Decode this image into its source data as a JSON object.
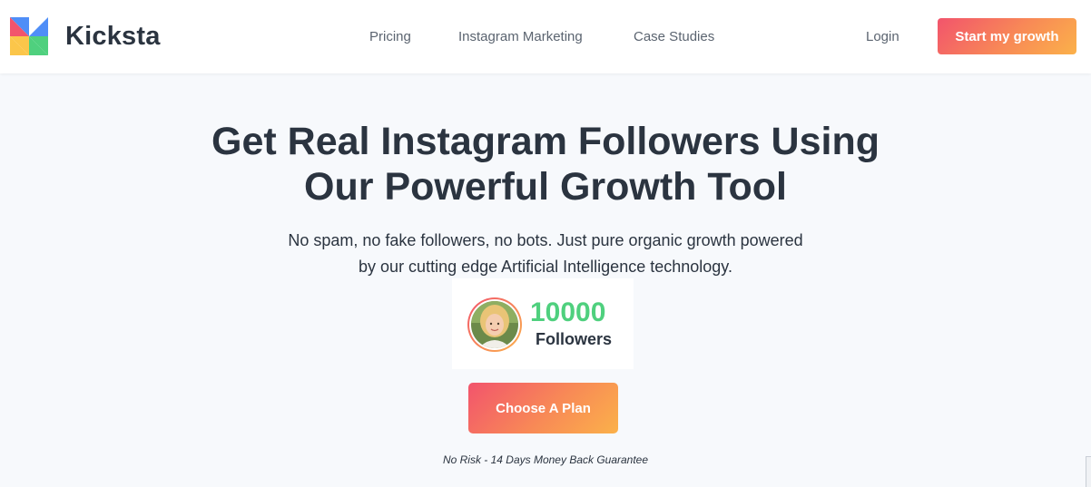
{
  "header": {
    "brand": "Kicksta",
    "nav": [
      {
        "label": "Pricing"
      },
      {
        "label": "Instagram Marketing"
      },
      {
        "label": "Case Studies"
      }
    ],
    "login_label": "Login",
    "cta_label": "Start my growth"
  },
  "hero": {
    "title_line1": "Get Real Instagram Followers Using",
    "title_line2": "Our Powerful Growth Tool",
    "subtitle_line1": "No spam, no fake followers, no bots. Just pure organic growth powered",
    "subtitle_line2": "by our cutting edge Artificial Intelligence technology.",
    "counter": {
      "value": "10000",
      "label": "Followers"
    },
    "cta_label": "Choose A Plan",
    "guarantee": "No Risk - 14 Days Money Back Guarantee"
  },
  "colors": {
    "accent_start": "#f2546c",
    "accent_end": "#fbb14a",
    "counter_green": "#4fd07e",
    "text_dark": "#2b3440",
    "page_bg": "#f7f9fc"
  },
  "icons": {
    "logo": "kicksta-pinwheel-icon",
    "avatar": "user-avatar"
  }
}
